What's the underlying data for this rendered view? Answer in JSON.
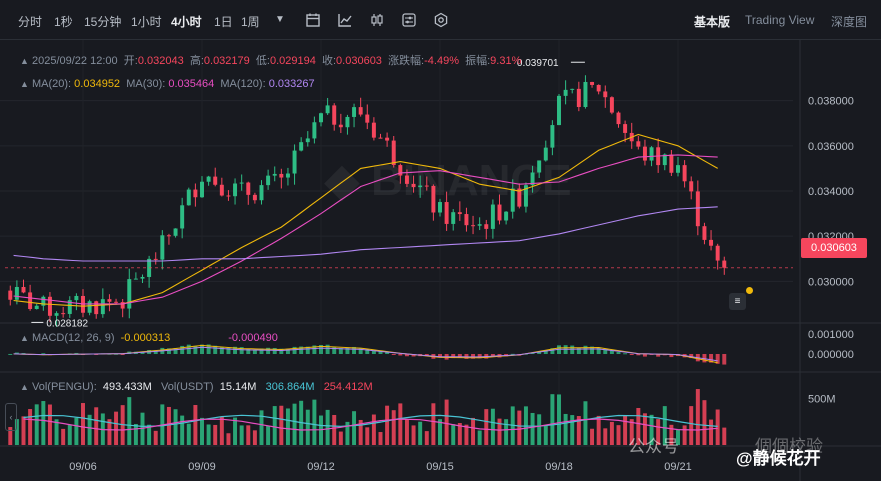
{
  "toolbar": {
    "timeframes": [
      "分时",
      "1秒",
      "15分钟",
      "1小时",
      "4小时",
      "1日",
      "1周"
    ],
    "active_timeframe": "4小时",
    "views": [
      "基本版",
      "Trading View",
      "深度图"
    ],
    "active_view": "基本版"
  },
  "ohlc": {
    "date": "2025/09/22 12:00",
    "open_label": "开:",
    "open": "0.032043",
    "high_label": "高:",
    "high": "0.032179",
    "low_label": "低:",
    "low": "0.029194",
    "close_label": "收:",
    "close": "0.030603",
    "change_label": "涨跌幅:",
    "change": "-4.49%",
    "amplitude_label": "振幅:",
    "amplitude": "9.31%"
  },
  "ma": {
    "ma20_label": "MA(20):",
    "ma20": "0.034952",
    "ma30_label": "MA(30):",
    "ma30": "0.035464",
    "ma120_label": "MA(120):",
    "ma120": "0.033267"
  },
  "macd": {
    "label": "MACD(12, 26, 9)",
    "value1": "-0.000313",
    "value2": "-0.000490"
  },
  "vol": {
    "label1": "Vol(PENGU):",
    "value1": "493.433M",
    "label2": "Vol(USDT)",
    "value2": "15.14M",
    "value3": "306.864M",
    "value4": "254.412M"
  },
  "price_axis": [
    "0.038000",
    "0.036000",
    "0.034000",
    "0.032000",
    "0.030000"
  ],
  "macd_axis": [
    "0.001000",
    "0.000000"
  ],
  "vol_axis": [
    "500M"
  ],
  "date_axis": [
    "09/06",
    "09/09",
    "09/12",
    "09/15",
    "09/18",
    "09/21"
  ],
  "current_price": "0.030603",
  "high_marker": "0.039701",
  "low_marker": "0.028182",
  "watermark": {
    "text1": "公众号",
    "text2": "@静候花开",
    "text3": "個個校验"
  },
  "colors": {
    "up": "#2ebd85",
    "down": "#f6465d",
    "ma20": "#f0b90b",
    "ma30": "#e84ec2",
    "ma120": "#b187f2",
    "background": "#181a20"
  },
  "chart_data": {
    "type": "candlestick",
    "interval": "4h",
    "x": [
      "09/04",
      "09/05",
      "09/06",
      "09/07",
      "09/08",
      "09/09",
      "09/10",
      "09/11",
      "09/12",
      "09/13",
      "09/14",
      "09/15",
      "09/16",
      "09/17",
      "09/18",
      "09/19",
      "09/20",
      "09/21",
      "09/22"
    ],
    "close": [
      0.0296,
      0.0288,
      0.0289,
      0.0292,
      0.0315,
      0.0348,
      0.0339,
      0.0344,
      0.0372,
      0.0375,
      0.0352,
      0.033,
      0.0325,
      0.0338,
      0.0378,
      0.0386,
      0.0357,
      0.0352,
      0.0306
    ],
    "ma20": [
      0.0292,
      0.029,
      0.0289,
      0.029,
      0.0295,
      0.0305,
      0.0315,
      0.0324,
      0.0337,
      0.035,
      0.0353,
      0.035,
      0.0343,
      0.034,
      0.0346,
      0.0358,
      0.0365,
      0.036,
      0.035
    ],
    "ma30": [
      0.0294,
      0.0292,
      0.029,
      0.029,
      0.0293,
      0.03,
      0.0309,
      0.0319,
      0.033,
      0.0342,
      0.0348,
      0.0349,
      0.0346,
      0.0343,
      0.0344,
      0.035,
      0.0355,
      0.0356,
      0.0355
    ],
    "ma120": [
      0.0312,
      0.031,
      0.0309,
      0.0309,
      0.0309,
      0.031,
      0.031,
      0.0311,
      0.0312,
      0.0314,
      0.0315,
      0.0316,
      0.0317,
      0.0318,
      0.0321,
      0.0325,
      0.0329,
      0.0332,
      0.0333
    ],
    "ylim": [
      0.0282,
      0.0398
    ],
    "macd_ylim": [
      -0.0008,
      0.0013
    ],
    "volume_ylim": [
      0,
      700
    ]
  }
}
